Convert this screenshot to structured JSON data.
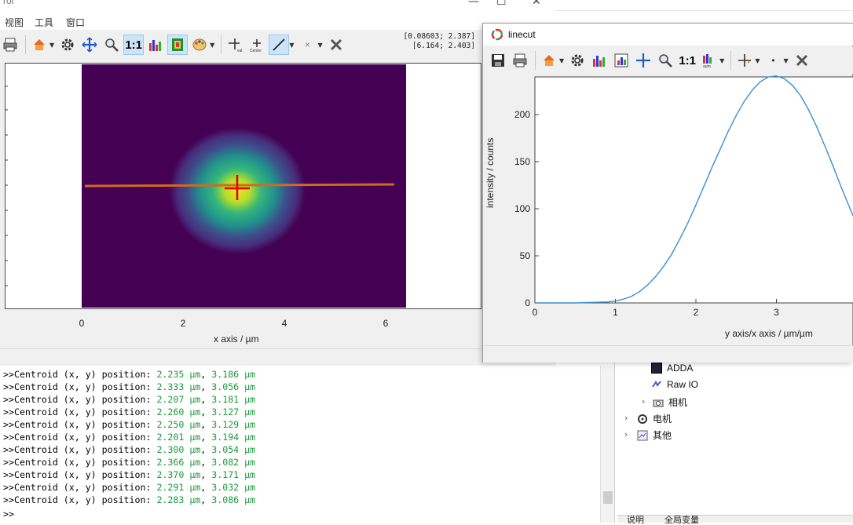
{
  "main_window": {
    "title": "roi",
    "menu": [
      "视图",
      "工具",
      "窗口"
    ],
    "coords_line1": "[0.08603; 2.387]",
    "coords_line2": "[6.164; 2.403]",
    "zoom_label": "1:1",
    "x_axis": {
      "label": "x axis / µm",
      "ticks": [
        "0",
        "2",
        "4",
        "6"
      ]
    },
    "colormap": "viridis",
    "colors": {
      "background_plot": "#440154",
      "linecut": "#d2691e",
      "marker": "#e00000"
    }
  },
  "linecut_window": {
    "title": "linecut",
    "zoom_label": "1:1",
    "chart_data": {
      "type": "line",
      "title": "",
      "xlabel": "y axis/x axis / µm/µm",
      "ylabel": "intensity / counts",
      "xlim": [
        0,
        4
      ],
      "ylim": [
        0,
        240
      ],
      "x_ticks": [
        "0",
        "1",
        "2",
        "3"
      ],
      "y_ticks": [
        "0",
        "50",
        "100",
        "150",
        "200"
      ],
      "grid": false,
      "series": [
        {
          "color": "#3a8fd0",
          "x": [
            0.0,
            0.5,
            0.9,
            1.0,
            1.1,
            1.2,
            1.3,
            1.4,
            1.5,
            1.6,
            1.7,
            1.8,
            1.9,
            2.0,
            2.1,
            2.2,
            2.3,
            2.4,
            2.5,
            2.6,
            2.7,
            2.8,
            2.9,
            3.0,
            3.1,
            3.2,
            3.3,
            3.4,
            3.5,
            3.6,
            3.7,
            3.8,
            3.9,
            4.0
          ],
          "y": [
            0,
            0,
            1,
            2,
            4,
            7,
            12,
            19,
            28,
            39,
            52,
            68,
            85,
            104,
            124,
            144,
            163,
            182,
            199,
            214,
            226,
            235,
            240,
            241,
            238,
            231,
            220,
            205,
            187,
            167,
            146,
            124,
            103,
            83
          ]
        }
      ]
    }
  },
  "console": {
    "prefix": ">>Centroid (x, y) position: ",
    "lines": [
      [
        "2.235 µm",
        "3.186 µm"
      ],
      [
        "2.333 µm",
        "3.056 µm"
      ],
      [
        "2.207 µm",
        "3.181 µm"
      ],
      [
        "2.260 µm",
        "3.127 µm"
      ],
      [
        "2.250 µm",
        "3.129 µm"
      ],
      [
        "2.201 µm",
        "3.194 µm"
      ],
      [
        "2.300 µm",
        "3.054 µm"
      ],
      [
        "2.366 µm",
        "3.082 µm"
      ],
      [
        "2.370 µm",
        "3.171 µm"
      ],
      [
        "2.291 µm",
        "3.032 µm"
      ],
      [
        "2.283 µm",
        "3.086 µm"
      ]
    ],
    "prompt": ">>"
  },
  "tree": {
    "items": [
      {
        "label": "ADDA",
        "icon": "adda-icon"
      },
      {
        "label": "Raw IO",
        "icon": "raw-io-icon"
      },
      {
        "label": "相机",
        "icon": "camera-icon"
      },
      {
        "label": "电机",
        "icon": "motor-icon"
      },
      {
        "label": "其他",
        "icon": "other-icon"
      }
    ]
  },
  "bottom_tabs": [
    "说明",
    "全局变量"
  ]
}
